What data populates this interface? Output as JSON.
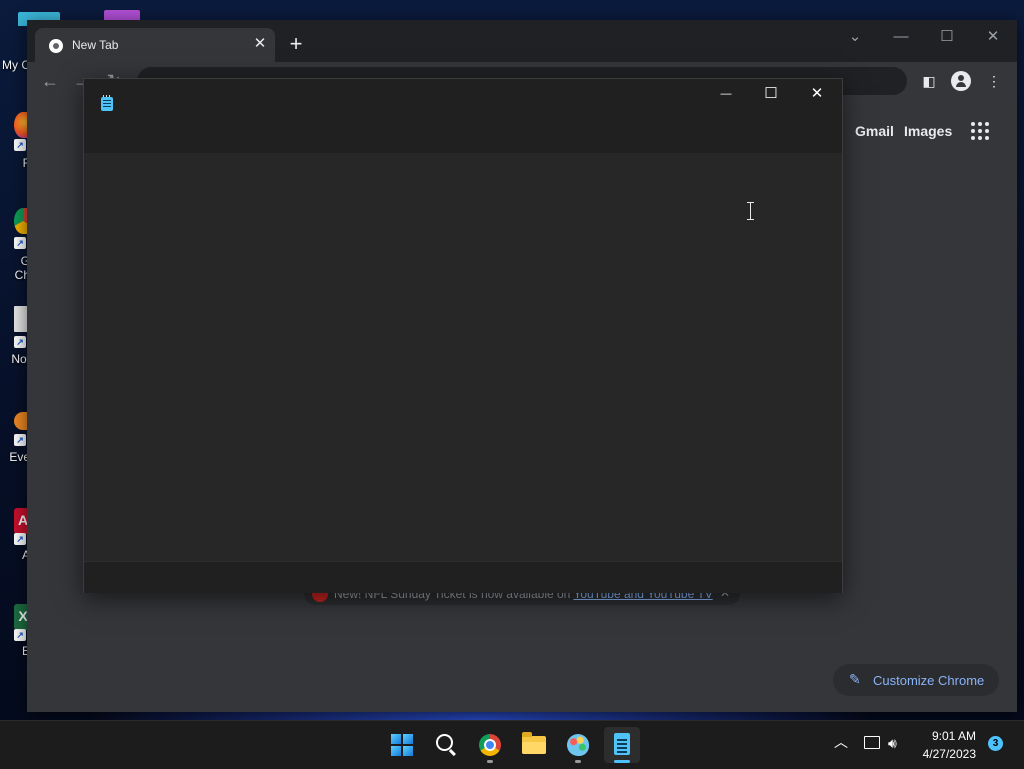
{
  "desktop": {
    "icons": [
      {
        "name": "my-computer",
        "label": "My C"
      },
      {
        "name": "firefox",
        "label": "F"
      },
      {
        "name": "google-chrome",
        "label": "G\nCh"
      },
      {
        "name": "notepad-plus",
        "label": "Not"
      },
      {
        "name": "everything",
        "label": "Eve"
      },
      {
        "name": "acrobat",
        "label": "A"
      },
      {
        "name": "excel",
        "label": "E"
      }
    ]
  },
  "chrome": {
    "tab_title": "New Tab",
    "tab_close": "✕",
    "new_tab": "+",
    "header_links": {
      "gmail": "Gmail",
      "images": "Images"
    },
    "promo": {
      "text": "New! NFL Sunday Ticket is now available on ",
      "link": "YouTube and YouTube TV",
      "close": "✕"
    },
    "customize_label": "Customize Chrome",
    "colors": {
      "frame": "#202124",
      "toolbar": "#35363a",
      "accent": "#8ab4f8"
    }
  },
  "notepad": {
    "title": "",
    "content": "",
    "controls": {
      "minimize": "—",
      "maximize": "☐",
      "close": "✕"
    }
  },
  "taskbar": {
    "apps": [
      "start-menu",
      "search",
      "google-chrome",
      "file-explorer",
      "paint",
      "notepad"
    ],
    "active_app": "notepad",
    "clock": {
      "time": "9:01 AM",
      "date": "4/27/2023"
    },
    "notification_count": "3"
  }
}
